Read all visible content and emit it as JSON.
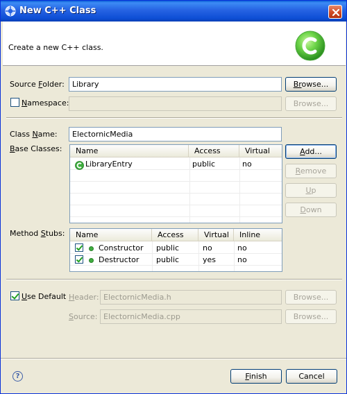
{
  "window": {
    "title": "New C++ Class",
    "header_text": "Create a new C++ class."
  },
  "source_folder": {
    "label_pre": "Source ",
    "label_ul": "F",
    "label_post": "older:",
    "value": "Library",
    "browse_ul": "Br",
    "browse_rest": "owse..."
  },
  "namespace": {
    "label_ul": "N",
    "label_rest": "amespace:",
    "value": "",
    "browse": "Browse..."
  },
  "class_name": {
    "label_pre": "Class ",
    "label_ul": "N",
    "label_post": "ame:",
    "value": "ElectornicMedia"
  },
  "base_classes": {
    "label_ul": "B",
    "label_rest": "ase Classes:",
    "columns": [
      "Name",
      "Access",
      "Virtual"
    ],
    "rows": [
      {
        "name": "LibraryEntry",
        "access": "public",
        "virtual": "no"
      }
    ],
    "add_ul": "A",
    "add_rest": "dd...",
    "remove_ul": "R",
    "remove_rest": "emove",
    "up_ul": "U",
    "up_rest": "p",
    "down_ul": "D",
    "down_rest": "own"
  },
  "method_stubs": {
    "label_pre": "Method ",
    "label_ul": "S",
    "label_post": "tubs:",
    "columns": [
      "Name",
      "Access",
      "Virtual",
      "Inline"
    ],
    "rows": [
      {
        "name": "Constructor",
        "access": "public",
        "virtual": "no",
        "inline": "no"
      },
      {
        "name": "Destructor",
        "access": "public",
        "virtual": "yes",
        "inline": "no"
      }
    ]
  },
  "use_default": {
    "label_ul": "U",
    "label_rest": "se Default",
    "checked": true
  },
  "header_file": {
    "label_ul": "H",
    "label_rest": "eader:",
    "value": "ElectornicMedia.h",
    "browse": "Browse..."
  },
  "source_file": {
    "label_ul": "S",
    "label_rest": "ource:",
    "value": "ElectornicMedia.cpp",
    "browse": "Browse..."
  },
  "footer": {
    "help_glyph": "?",
    "finish_ul": "F",
    "finish_rest": "inish",
    "cancel": "Cancel"
  },
  "colors": {
    "titlebar": "#2663e3",
    "dialog_bg": "#ece9d8",
    "logo_green": "#3fae3f"
  },
  "icons": {
    "title": "eclipse-cdt-icon",
    "logo": "c-class-logo-icon",
    "close": "close-icon",
    "class_entry": "class-icon",
    "method": "method-dot-icon",
    "help": "help-icon"
  }
}
